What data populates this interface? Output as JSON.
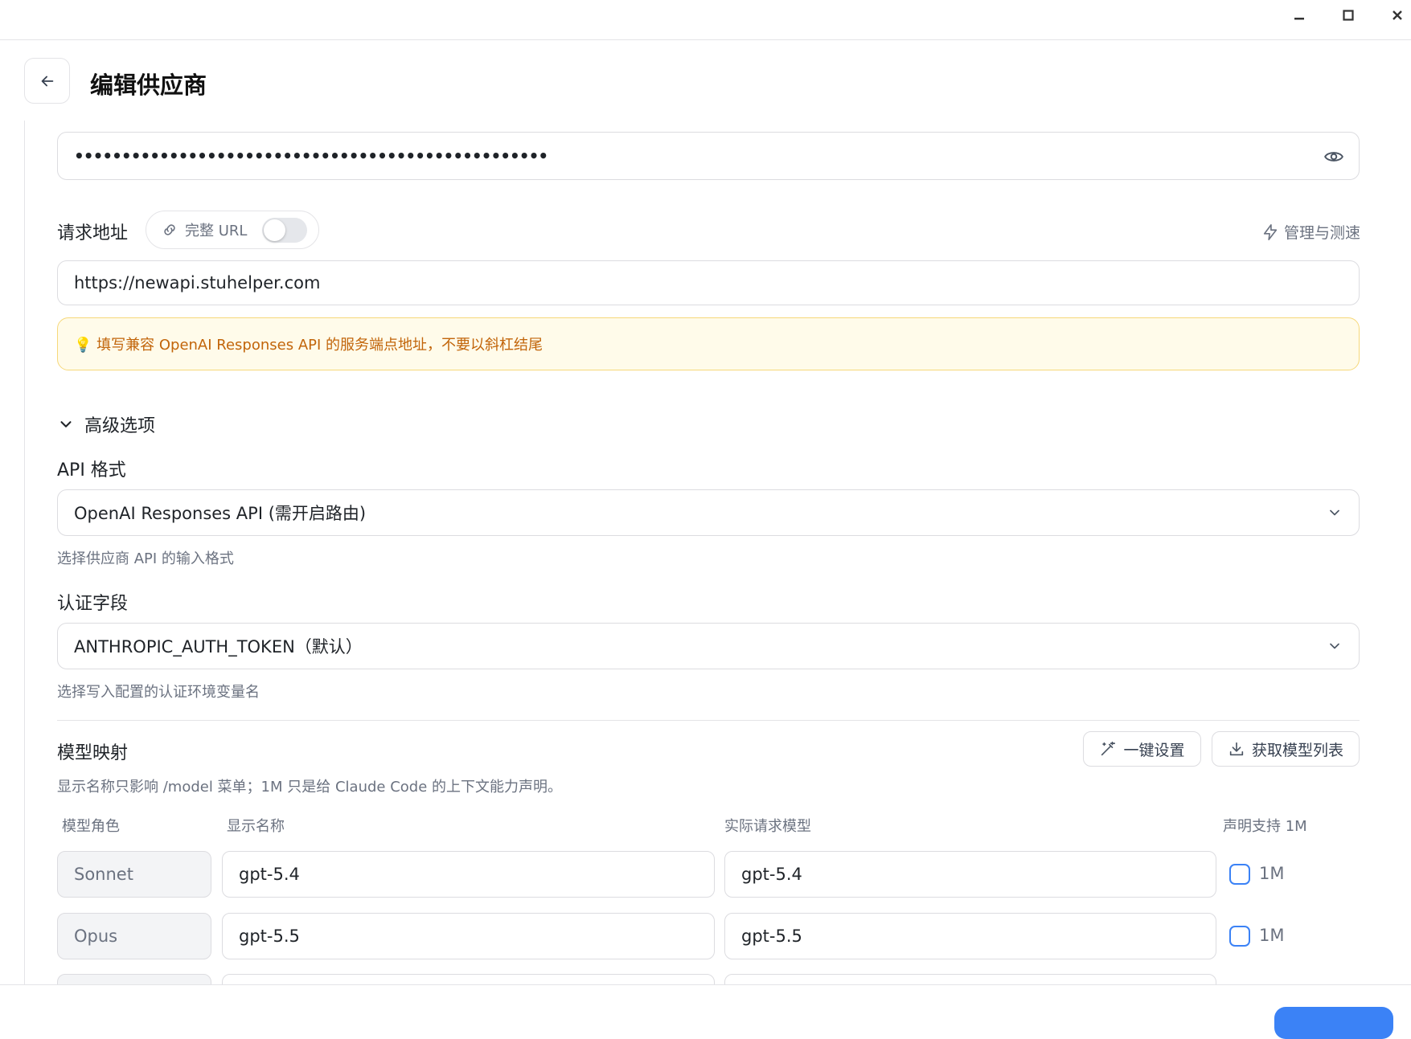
{
  "window": {
    "minimize_label": "minimize",
    "maximize_label": "maximize",
    "close_label": "close"
  },
  "header": {
    "title": "编辑供应商"
  },
  "api_key": {
    "value": "••••••••••••••••••••••••••••••••••••••••••••••••••"
  },
  "endpoint": {
    "label": "请求地址",
    "full_url_toggle_label": "完整 URL",
    "full_url_enabled": false,
    "manage_label": "管理与测速",
    "value": "https://newapi.stuhelper.com",
    "notice": "💡 填写兼容 OpenAI Responses API 的服务端点地址，不要以斜杠结尾"
  },
  "advanced": {
    "toggle_label": "高级选项",
    "api_format": {
      "label": "API 格式",
      "value": "OpenAI Responses API (需开启路由)",
      "hint": "选择供应商 API 的输入格式"
    },
    "auth_field": {
      "label": "认证字段",
      "value": "ANTHROPIC_AUTH_TOKEN（默认）",
      "hint": "选择写入配置的认证环境变量名"
    }
  },
  "model_mapping": {
    "title": "模型映射",
    "description": "显示名称只影响 /model 菜单；1M 只是给 Claude Code 的上下文能力声明。",
    "one_click_label": "一键设置",
    "fetch_models_label": "获取模型列表",
    "columns": [
      "模型角色",
      "显示名称",
      "实际请求模型",
      "声明支持 1M"
    ],
    "rows": [
      {
        "role": "Sonnet",
        "display": "gpt-5.4",
        "actual": "gpt-5.4",
        "one_m_label": "1M",
        "one_m_checked": false
      },
      {
        "role": "Opus",
        "display": "gpt-5.5",
        "actual": "gpt-5.5",
        "one_m_label": "1M",
        "one_m_checked": false
      }
    ]
  },
  "colors": {
    "accent": "#3b82f6",
    "notice_bg": "#fffbea",
    "notice_text": "#c2650a"
  }
}
